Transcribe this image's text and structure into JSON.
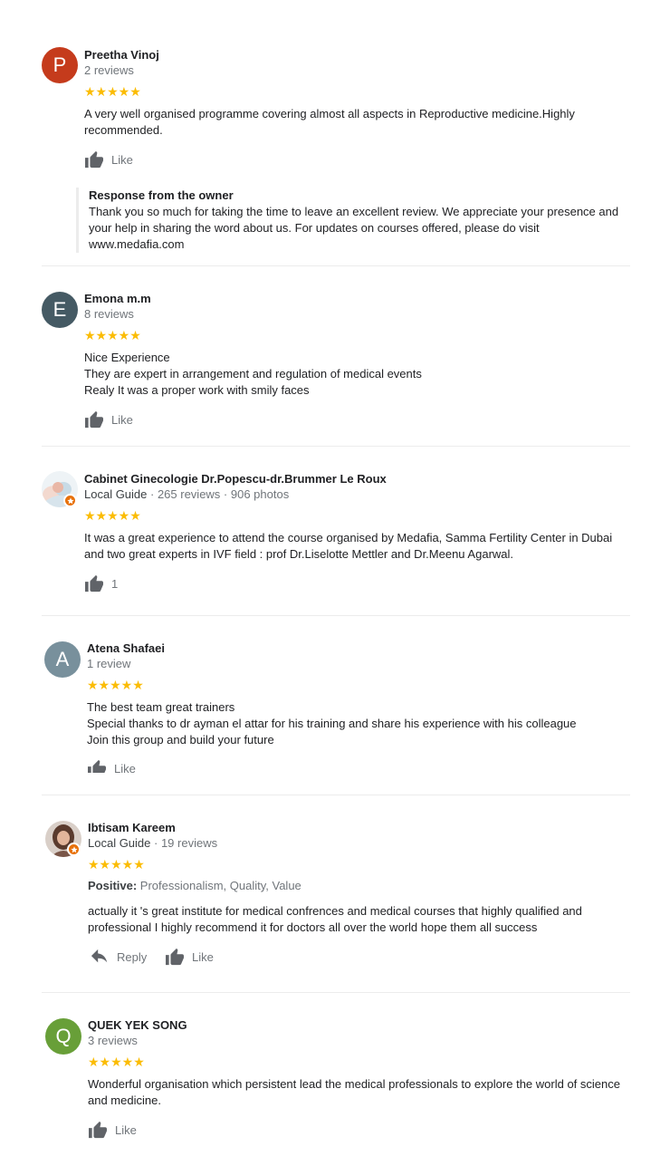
{
  "like_label": "Like",
  "reply_label": "Reply",
  "stars_text": "★★★★★",
  "reviews": [
    {
      "initial": "P",
      "avatar_color": "#c53b1c",
      "name": "Preetha Vinoj",
      "meta": "2 reviews",
      "lines": [
        "A very well organised programme covering almost all aspects in Reproductive medicine.Highly",
        "recommended."
      ],
      "owner_response": {
        "title": "Response from the owner",
        "lines": [
          "Thank you so much for taking the time to leave an excellent review. We appreciate your presence and",
          "your help in sharing the word about us. For updates on courses offered, please do visit",
          "www.medafia.com"
        ]
      }
    },
    {
      "initial": "E",
      "avatar_color": "#455a64",
      "name": "Emona m.m",
      "meta": "8 reviews",
      "lines": [
        "Nice Experience",
        "They are expert in arrangement and regulation of medical events",
        "Realy It was a proper work with smily faces"
      ]
    },
    {
      "name": "Cabinet Ginecologie Dr.Popescu-dr.Brummer Le Roux",
      "meta": "Local Guide · 265 reviews · 906 photos",
      "local_guide": "Local Guide",
      "meta_rest": " · 265 reviews · 906 photos",
      "lines": [
        "It was a great experience to attend the course organised by Medafia, Samma Fertility Center in Dubai",
        "and two great experts in IVF field : prof Dr.Liselotte Mettler and Dr.Meenu Agarwal."
      ],
      "like_count": "1"
    },
    {
      "initial": "A",
      "avatar_color": "#78909c",
      "name": "Atena Shafaei",
      "meta": "1 review",
      "lines": [
        "The best team great trainers",
        "Special thanks to dr ayman el attar for his training and share his experience with his colleague",
        "Join this group and build your future"
      ]
    },
    {
      "name": "Ibtisam Kareem",
      "local_guide": "Local Guide",
      "meta_rest": " · 19 reviews",
      "positive_label": "Positive:",
      "positive_text": " Professionalism, Quality, Value",
      "lines": [
        "actually it 's great institute for medical confrences and medical courses that highly qualified and",
        "professional I highly recommend it for doctors all over the world hope them all success"
      ]
    },
    {
      "initial": "Q",
      "avatar_color": "#689f38",
      "name": "QUEK YEK SONG",
      "meta": "3 reviews",
      "lines": [
        "Wonderful organisation which persistent lead the medical professionals to explore the world of science",
        "and medicine."
      ]
    }
  ]
}
